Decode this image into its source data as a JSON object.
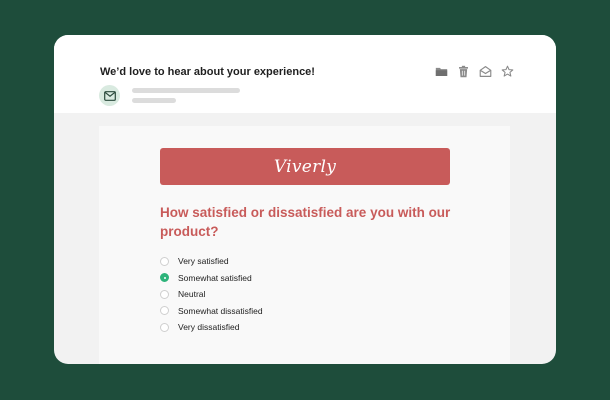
{
  "email": {
    "subject": "We’d love to hear about your experience!",
    "toolbar": {
      "icons": [
        "folder-icon",
        "trash-icon",
        "open-envelope-icon",
        "star-icon"
      ]
    },
    "sender": {
      "avatar_icon": "mail-icon"
    }
  },
  "body": {
    "brand": "Viverly",
    "brand_color": "#c85b5a",
    "question": "How satisfied or dissatisfied are you with our product?",
    "selected_option": "Somewhat satisfied",
    "options": [
      {
        "label": "Very satisfied",
        "selected": false
      },
      {
        "label": "Somewhat satisfied",
        "selected": true
      },
      {
        "label": "Neutral",
        "selected": false
      },
      {
        "label": "Somewhat dissatisfied",
        "selected": false
      },
      {
        "label": "Very dissatisfied",
        "selected": false
      }
    ]
  },
  "colors": {
    "background": "#1e4d3b",
    "accent": "#c85b5a",
    "selected_radio": "#2db37a"
  }
}
